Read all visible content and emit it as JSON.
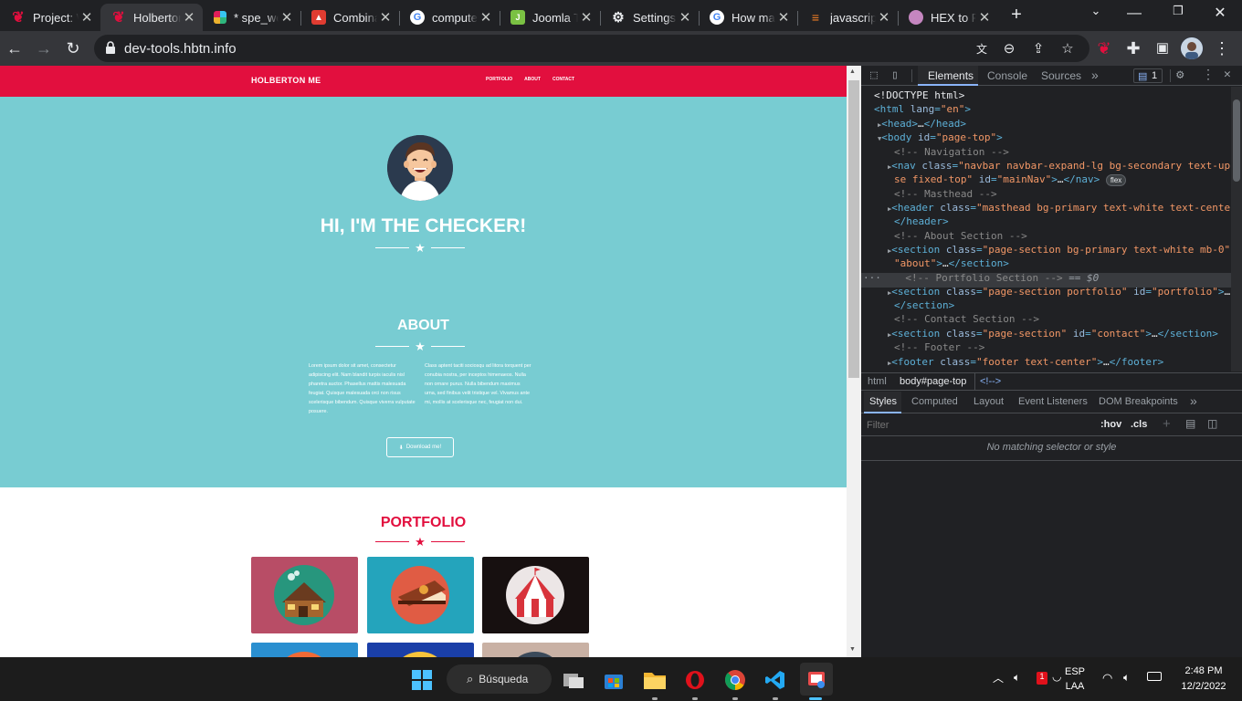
{
  "browser": {
    "tabs": [
      {
        "title": "Project: Web",
        "icon": "holberton-icon",
        "color": "#e20f3e",
        "active": false
      },
      {
        "title": "Holberton",
        "icon": "holberton-icon",
        "color": "#e20f3e",
        "active": true
      },
      {
        "title": "* spe_web",
        "icon": "slack-icon",
        "color": "#611f69",
        "active": false
      },
      {
        "title": "Combination",
        "icon": "combination-icon",
        "color": "#e03c31",
        "active": false
      },
      {
        "title": "computer",
        "icon": "google-icon",
        "color": "#4285f4",
        "active": false
      },
      {
        "title": "Joomla Tutorial",
        "icon": "joomla-icon",
        "color": "#7ac143",
        "active": false
      },
      {
        "title": "Settings",
        "icon": "gear-icon",
        "color": "#9aa0a6",
        "active": false
      },
      {
        "title": "How many",
        "icon": "google-icon",
        "color": "#4285f4",
        "active": false
      },
      {
        "title": "javascript",
        "icon": "stackoverflow-icon",
        "color": "#f48024",
        "active": false
      },
      {
        "title": "HEX to RGB",
        "icon": "circle-icon",
        "color": "#c586c0",
        "active": false
      }
    ],
    "url": "dev-tools.hbtn.info"
  },
  "site": {
    "nav": {
      "brand": "HOLBERTON ME",
      "links": [
        "PORTFOLIO",
        "ABOUT",
        "CONTACT"
      ]
    },
    "masthead": {
      "title": "HI, I'M THE CHECKER!"
    },
    "about": {
      "title": "ABOUT",
      "col1": "Lorem ipsum dolor sit amet, consectetur adipiscing elit. Nam blandit turpis iaculis nisl pharetra auctor. Phasellus mattis malesuada feugiat. Quisque malesuada orci non risus scelerisque bibendum. Quisque viverra vulputate posuere.",
      "col2": "Class aptent taciti sociosqu ad litora torquent per conubia nostra, per inceptos himenaeos. Nulla non ornare purus. Nulla bibendum maximus urna, sed finibus velit tristique vel. Vivamus ante mi, mollis at scelerisque nec, feugiat non dui.",
      "button": "Download me!"
    },
    "portfolio": {
      "title": "PORTFOLIO",
      "tiles": [
        {
          "name": "cabin",
          "bg": "#b84d66"
        },
        {
          "name": "cake",
          "bg": "#24a4bc"
        },
        {
          "name": "circus",
          "bg": "#171010"
        },
        {
          "name": "game",
          "bg": "#2a8fd0"
        },
        {
          "name": "safe",
          "bg": "#1a3fa8"
        },
        {
          "name": "submarine",
          "bg": "#c9b1a4"
        }
      ]
    }
  },
  "devtools": {
    "tabs": [
      "Elements",
      "Console",
      "Sources"
    ],
    "issues": "1",
    "tree": {
      "doctype": "<!DOCTYPE html>",
      "html_tag": "html",
      "html_attr": "lang",
      "html_val": "\"en\"",
      "head": "head",
      "body_tag": "body",
      "body_attr": "id",
      "body_val": "\"page-top\"",
      "c_nav": "<!-- Navigation -->",
      "nav_tag": "nav",
      "nav_class": "\"navbar navbar-expand-lg bg-secondary text-upperca",
      "nav_class2": "se fixed-top\"",
      "nav_id": "\"mainNav\"",
      "flex_pill": "flex",
      "c_mast": "<!-- Masthead -->",
      "header_tag": "header",
      "header_class": "\"masthead bg-primary text-white text-center\"",
      "c_about": "<!-- About Section -->",
      "sec_about_class": "\"page-section bg-primary text-white mb-0\"",
      "sec_about_id": "\"about\"",
      "c_port": "<!-- Portfolio Section -->",
      "eq0": "== $0",
      "sec_port_class": "\"page-section portfolio\"",
      "sec_port_id": "\"portfolio\"",
      "c_contact": "<!-- Contact Section -->",
      "sec_contact_class": "\"page-section\"",
      "sec_contact_id": "\"contact\"",
      "c_footer": "<!-- Footer -->",
      "footer_class": "\"footer text-center\""
    },
    "breadcrumb": [
      "html",
      "body#page-top",
      "<!-->"
    ],
    "style_tabs": [
      "Styles",
      "Computed",
      "Layout",
      "Event Listeners",
      "DOM Breakpoints"
    ],
    "filter_placeholder": "Filter",
    "hov": ":hov",
    "cls": ".cls",
    "no_match": "No matching selector or style"
  },
  "taskbar": {
    "search": "Búsqueda",
    "lang": "ESP",
    "lang2": "LAA",
    "time": "2:48 PM",
    "date": "12/2/2022"
  }
}
